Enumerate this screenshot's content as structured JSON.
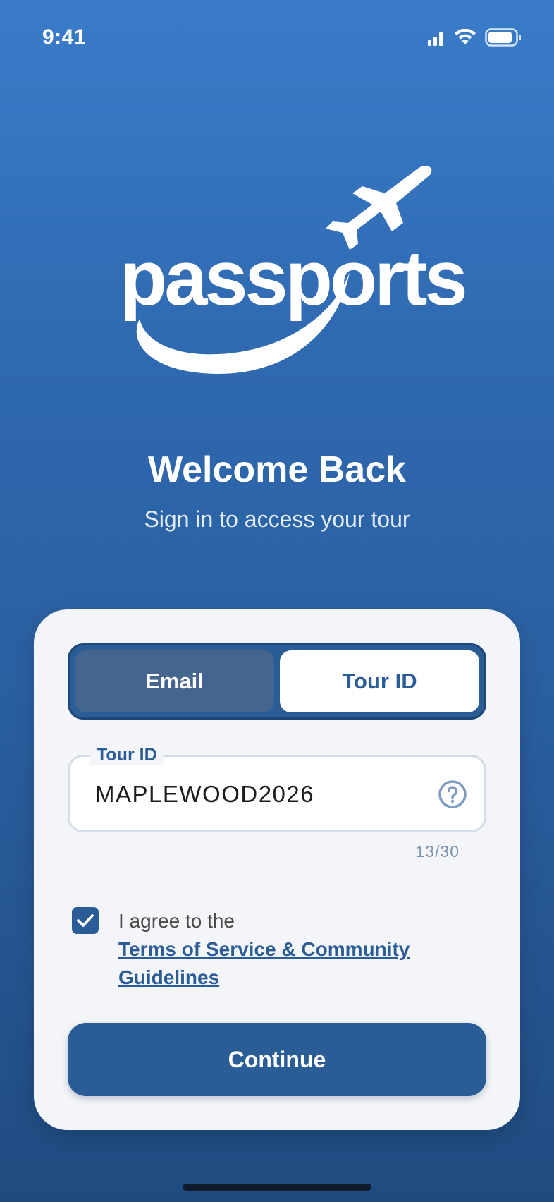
{
  "status_bar": {
    "time": "9:41"
  },
  "logo": {
    "text": "passports"
  },
  "welcome": {
    "title": "Welcome Back",
    "subtitle": "Sign in to access your tour"
  },
  "login_method": {
    "options": [
      "Email",
      "Tour ID"
    ],
    "selected": "Tour ID"
  },
  "tour_id_field": {
    "label": "Tour ID",
    "value": "MAPLEWOOD2026",
    "counter": "13/30"
  },
  "agreement": {
    "checked": true,
    "prefix": "I agree to the",
    "link_text": "Terms of Service & Community Guidelines"
  },
  "continue_button": {
    "label": "Continue"
  },
  "colors": {
    "primary": "#2a5c96",
    "background_top": "#3a7cc9",
    "background_bottom": "#1f4b80",
    "card": "#f3f5f8"
  }
}
